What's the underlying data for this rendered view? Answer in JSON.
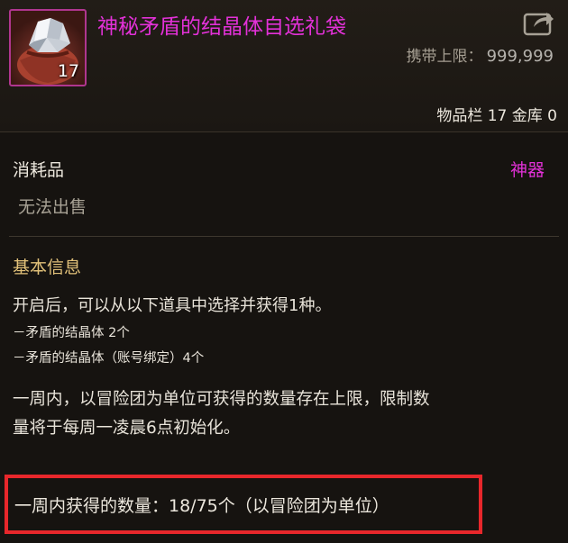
{
  "item": {
    "name": "神秘矛盾的结晶体自选礼袋",
    "stack_count": "17",
    "icon": "crystal-bag-icon",
    "carry_limit_label": "携带上限：",
    "carry_limit_value": "999,999",
    "storage": "物品栏 17 金库 0",
    "type": "消耗品",
    "rarity": "神器",
    "tradable": "无法出售"
  },
  "info": {
    "title": "基本信息",
    "description": "开启后，可以从以下道具中选择并获得1种。",
    "options": [
      "－矛盾的结晶体 2个",
      "－矛盾的结晶体（账号绑定）4个"
    ],
    "limit_lines": [
      "一周内，以冒险团为单位可获得的数量存在上限，限制数",
      "量将于每周一凌晨6点初始化。"
    ],
    "weekly_count": "一周内获得的数量：18/75个（以冒险团为单位）"
  },
  "colors": {
    "name": "#e331d8",
    "rarity": "#e331d8",
    "section_title": "#e3c27a",
    "highlight_border": "#e8272b"
  }
}
